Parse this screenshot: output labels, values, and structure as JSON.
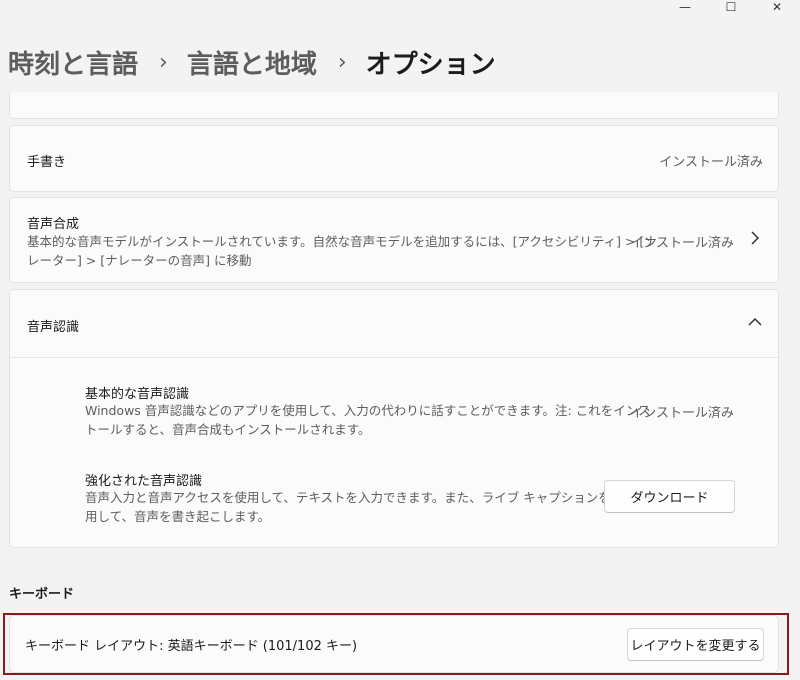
{
  "breadcrumb": {
    "item1": "時刻と言語",
    "item2": "言語と地域",
    "current": "オプション",
    "separator": "›"
  },
  "window_controls": {
    "minimize": "—",
    "maximize": "☐",
    "close": "✕"
  },
  "handwriting": {
    "title": "手書き",
    "status": "インストール済み"
  },
  "speech_synthesis": {
    "title": "音声合成",
    "description_line1": "基本的な音声モデルがインストールされています。自然な音声モデルを追加するには、[アクセシビリティ] > [ナ",
    "description_line2": "レーター] > [ナレーターの音声] に移動",
    "status": "インストール済み"
  },
  "speech_recognition": {
    "title": "音声認識",
    "basic": {
      "title": "基本的な音声認識",
      "description_line1": "Windows 音声認識などのアプリを使用して、入力の代わりに話すことができます。注: これをインス",
      "description_line2": "トールすると、音声合成もインストールされます。",
      "status": "インストール済み"
    },
    "enhanced": {
      "title": "強化された音声認識",
      "description_line1": "音声入力と音声アクセスを使用して、テキストを入力できます。また、ライブ キャプションを使",
      "description_line2": "用して、音声を書き起こします。",
      "button": "ダウンロード"
    }
  },
  "keyboard": {
    "section_title": "キーボード",
    "layout_label": "キーボード レイアウト: 英語キーボード (101/102 キー)",
    "change_button": "レイアウトを変更する"
  },
  "colors": {
    "background": "#f3f3f3",
    "card": "#fbfbfb",
    "highlight_border": "#8b1a1a"
  }
}
